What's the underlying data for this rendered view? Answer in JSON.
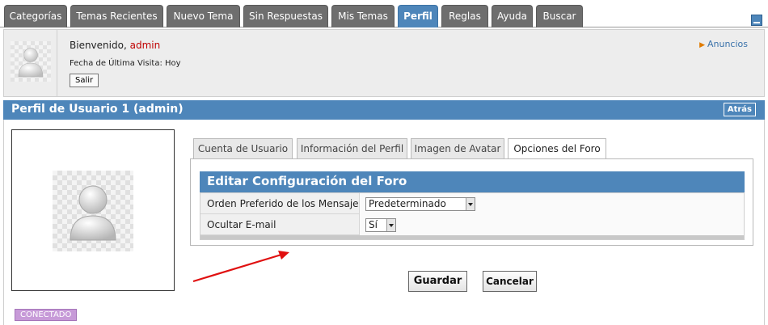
{
  "nav": {
    "tabs": [
      {
        "label": "Categorías"
      },
      {
        "label": "Temas Recientes"
      },
      {
        "label": "Nuevo Tema"
      },
      {
        "label": "Sin Respuestas"
      },
      {
        "label": "Mis Temas"
      },
      {
        "label": "Perfil"
      },
      {
        "label": "Reglas"
      },
      {
        "label": "Ayuda"
      },
      {
        "label": "Buscar"
      }
    ],
    "active": "Perfil"
  },
  "welcome": {
    "greeting": "Bienvenido,",
    "username": "admin",
    "last_visit": "Fecha de Última Visita: Hoy",
    "logout_label": "Salir",
    "announcements_label": "Anuncios"
  },
  "profile": {
    "title": "Perfil de Usuario 1 (admin)",
    "back_label": "Atrás",
    "status": "CONECTADO"
  },
  "subtabs": [
    {
      "label": "Cuenta de Usuario"
    },
    {
      "label": "Información del Perfil"
    },
    {
      "label": "Imagen de Avatar"
    },
    {
      "label": "Opciones del Foro"
    }
  ],
  "config": {
    "title": "Editar Configuración del Foro",
    "rows": [
      {
        "label": "Orden Preferido de los Mensajes",
        "value": "Predeterminado"
      },
      {
        "label": "Ocultar E-mail",
        "value": "Sí"
      }
    ]
  },
  "actions": {
    "save_label": "Guardar",
    "cancel_label": "Cancelar"
  },
  "colors": {
    "accent": "#4e86ba",
    "tab_bg": "#6e6e6e",
    "username": "#c00000",
    "annotation_arrow": "#e01010",
    "status_badge": "#c79ad8"
  }
}
